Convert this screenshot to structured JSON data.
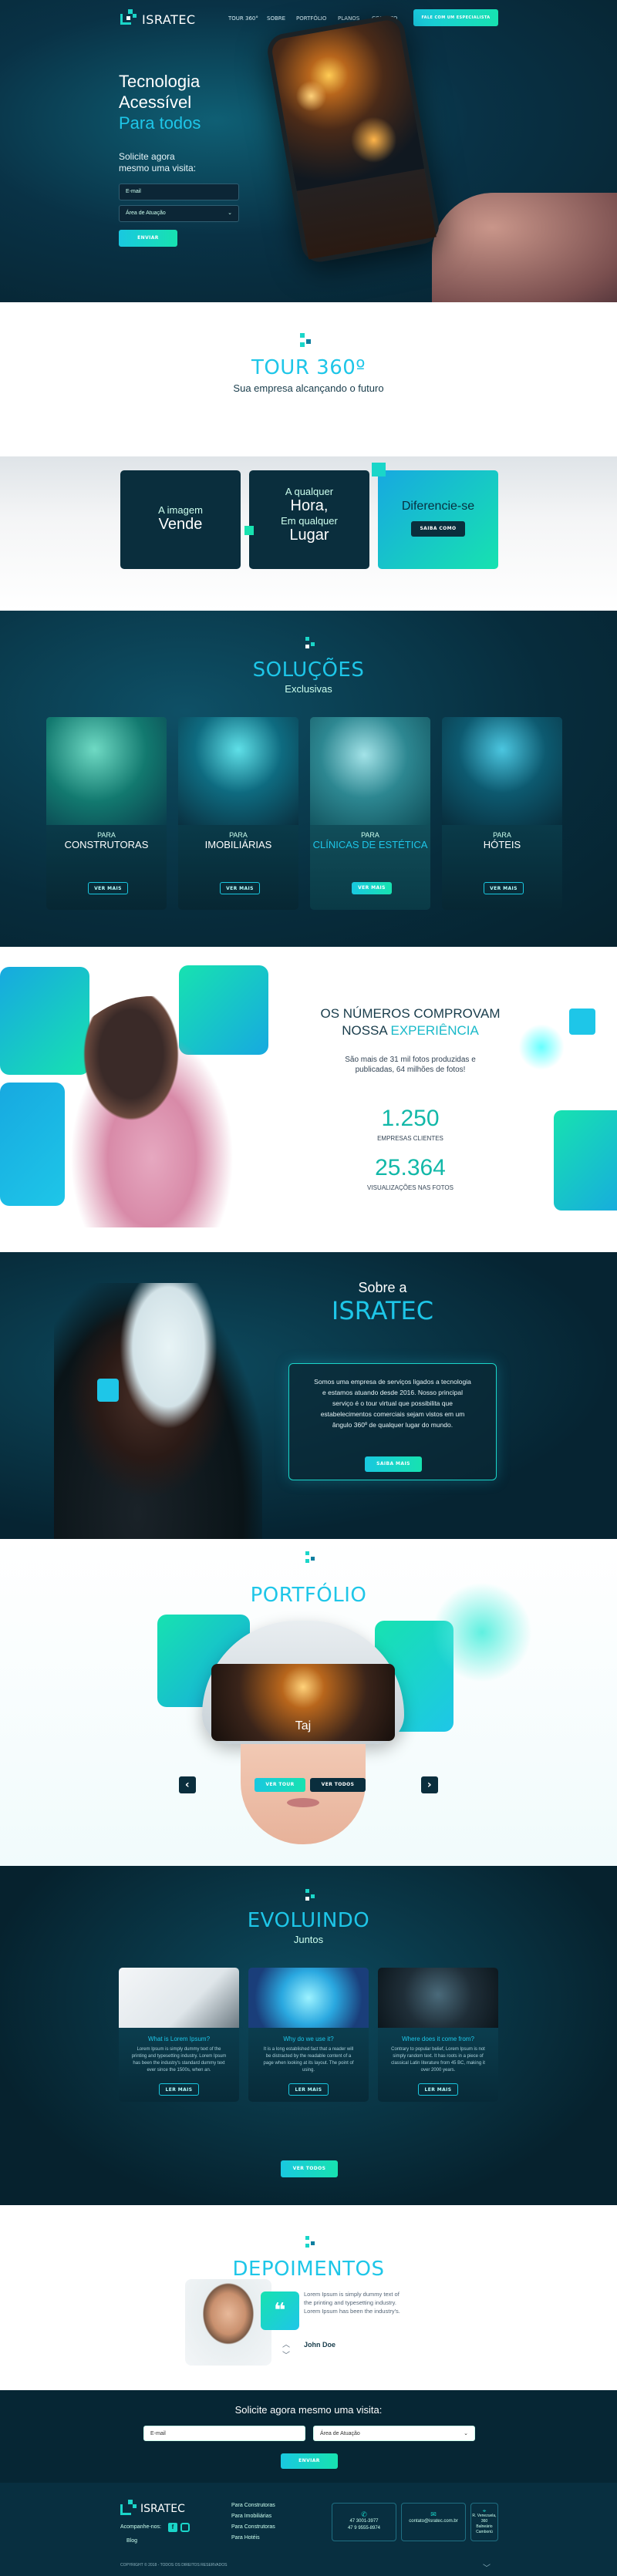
{
  "nav": {
    "brand": "ISRATEC",
    "links": [
      "TOUR 360°",
      "SOBRE",
      "PORTFÓLIO",
      "PLANOS",
      "CONTATO"
    ],
    "cta": "FALE COM UM ESPECIALISTA"
  },
  "hero": {
    "line1": "Tecnologia",
    "line2": "Acessível",
    "line3": "Para todos",
    "ask1": "Solicite agora",
    "ask2": "mesmo uma visita:",
    "email": "E-mail",
    "area": "Área de Atuação",
    "button": "ENVIAR"
  },
  "tour": {
    "title": "TOUR 360º",
    "subtitle": "Sua empresa alcançando o futuro"
  },
  "features": {
    "c1a": "A imagem",
    "c1b": "Vende",
    "c2a": "A qualquer",
    "c2b": "Hora,",
    "c2c": "Em qualquer",
    "c2d": "Lugar",
    "c3": "Diferencie-se",
    "c3btn": "SAIBA COMO"
  },
  "solucoes": {
    "title": "SOLUÇÕES",
    "subtitle": "Exclusivas",
    "cards": [
      {
        "pre": "PARA",
        "name": "CONSTRUTORAS",
        "btn": "VER MAIS"
      },
      {
        "pre": "PARA",
        "name": "IMOBILIÁRIAS",
        "btn": "VER MAIS"
      },
      {
        "pre": "PARA",
        "name": "CLÍNICAS DE ESTÉTICA",
        "btn": "VER MAIS"
      },
      {
        "pre": "PARA",
        "name": "HÓTEIS",
        "btn": "VER MAIS"
      }
    ]
  },
  "numeros": {
    "t1": "OS NÚMEROS COMPROVAM",
    "t2a": "NOSSA ",
    "t2b": "EXPERIÊNCIA",
    "desc": "São mais de 31 mil fotos produzidas e publicadas, 64 milhões de fotos!",
    "n1": "1.250",
    "l1": "EMPRESAS CLIENTES",
    "n2": "25.364",
    "l2": "VISUALIZAÇÕES NAS FOTOS"
  },
  "sobre": {
    "t1": "Sobre a",
    "t2": "ISRATEC",
    "text": "Somos uma empresa de serviços ligados a tecnologia e estamos atuando desde 2016. Nosso principal serviço é o tour virtual que possibilita que estabelecimentos comerciais sejam vistos em um ângulo 360º de qualquer lugar do mundo.",
    "btn": "SAIBA MAIS"
  },
  "portfolio": {
    "title": "PORTFÓLIO",
    "place": "Taj",
    "btn1": "VER TOUR",
    "btn2": "VER TODOS",
    "prev": "‹",
    "next": "›"
  },
  "evoluindo": {
    "title": "EVOLUINDO",
    "subtitle": "Juntos",
    "cards": [
      {
        "h": "What is Lorem Ipsum?",
        "p": "Lorem Ipsum is simply dummy text of the printing and typesetting industry. Lorem Ipsum has been the industry's standard dummy text ever since the 1500s, when an.",
        "btn": "LER MAIS"
      },
      {
        "h": "Why do we use it?",
        "p": "It is a long established fact that a reader will be distracted by the readable content of a page when looking at its layout. The point of using.",
        "btn": "LER MAIS"
      },
      {
        "h": "Where does it come from?",
        "p": "Contrary to popular belief, Lorem Ipsum is not simply random text. It has roots in a piece of classical Latin literature from 45 BC, making it over 2000 years.",
        "btn": "LER MAIS"
      }
    ],
    "all": "VER TODOS"
  },
  "depoimentos": {
    "title": "DEPOIMENTOS",
    "quote": "Lorem Ipsum is simply dummy text of the printing and typesetting industry. Lorem Ipsum has been the industry's.",
    "author": "John Doe",
    "qmark": "❝",
    "up": "︿",
    "down": "﹀"
  },
  "visita": {
    "title": "Solicite agora mesmo uma visita:",
    "email": "E-mail",
    "area": "Área de Atuação",
    "btn": "ENVIAR"
  },
  "footer": {
    "brand": "ISRATEC",
    "follow": "Acompanhe-nos:",
    "blog": "Blog",
    "links": [
      "Para Construtoras",
      "Para Imobiliárias",
      "Para Construtoras",
      "Para Hotéis"
    ],
    "phone": "47 3001-3977\n47 9 9555-8974",
    "email": "contato@isratec.com.br",
    "address": "R. Venezuela, 360\nBalneário Camboriú",
    "copy": "COPYRIGHT © 2018 - TODOS OS DIREITOS RESERVADOS"
  },
  "colors": {
    "accent": "#1ec6e8",
    "teal": "#17e2b0",
    "dark": "#06222e"
  }
}
